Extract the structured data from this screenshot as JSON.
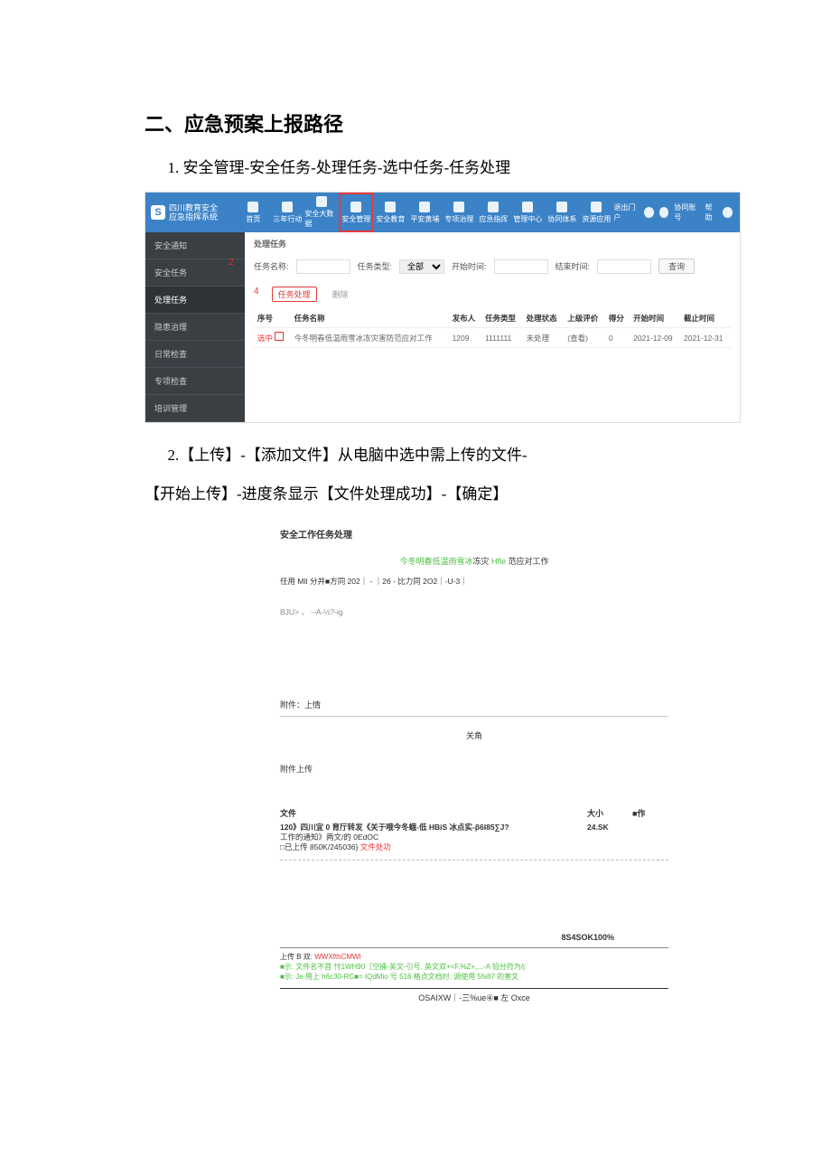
{
  "heading": "二、应急预案上报路径",
  "step1": "1. 安全管理-安全任务-处理任务-选中任务-任务处理",
  "step2a": "2.【上传】-【添加文件】从电脑中选中需上传的文件-",
  "step2b": "【开始上传】-进度条显示【文件处理成功】-【确定】",
  "shot1": {
    "brand1": "四川教育安全",
    "brand2": "应急指挥系统",
    "nav": [
      "首页",
      "三年行动",
      "安全大数据",
      "安全管理",
      "安全教育",
      "平安黄埔",
      "专项治理",
      "应急指挥",
      "管理中心",
      "协同体系",
      "资源应用"
    ],
    "rightnav": [
      "退出门户",
      "消息",
      "代办",
      "协同账号",
      "帮助",
      "在线客服"
    ],
    "sidebar": [
      "安全通知",
      "安全任务",
      "处理任务",
      "隐患治理",
      "日常检查",
      "专项检查",
      "培训管理"
    ],
    "red2": "2",
    "red4": "4",
    "crumb": "处理任务",
    "f_name": "任务名称:",
    "f_type": "任务类型:",
    "f_type_val": "全部",
    "f_start": "开始时间:",
    "f_end": "结束时间:",
    "f_query": "查询",
    "op_handle": "任务处理",
    "op_del": "删除",
    "thead": [
      "序号",
      "任务名称",
      "发布人",
      "任务类型",
      "处理状态",
      "上级评价",
      "得分",
      "开始时间",
      "截止时间"
    ],
    "row": {
      "seq": "",
      "name": "今冬明春低温雨雪冰冻灾害防范应对工作",
      "pub": "1209",
      "type": "1111111",
      "status": "未处理",
      "eval": "(查看)",
      "score": "0",
      "start": "2021-12-09",
      "end": "2021-12-31"
    },
    "selecting": "选中"
  },
  "shot2": {
    "title": "安全工作任务处理",
    "subtitle_a": "今冬明春低温雨雪冰",
    "subtitle_b": "冻灾",
    "subtitle_c": "Hfle",
    "subtitle_d": "范应对工作",
    "meta": "任用 MlI 分并■方同 202｜ - ｜26 - 比力同 2O2｜-U-3｜",
    "editor": "BJU> 、 --A-½?-ig",
    "attach_label": "附件：上情",
    "close": "关角",
    "upload_label": "附件上传",
    "th_file": "文件",
    "th_size": "大小",
    "th_op": "■作",
    "file_line1a": "120》四川宜 0 育厅转发《关于哦今冬蛾-低 HBiS 冰点实-β6I85∑J?",
    "file_line1b": "工作的通知》两文/的 0EdOC",
    "file_size": "24.SK",
    "file_line2a": "□已上传 850K/245036}",
    "file_line2b": "文件处功",
    "pct": "8S4SOK100%",
    "hint1a": "上传 B 双: ",
    "hint1b": "WWXfthCMWI",
    "hint2": "■示: 文件名不首 忖1WH90［空捅-英文-引号. 英文双+<F.%Z+,...-A 铅分符为/j",
    "hint3": "■示: Je 用上 h6c30-RC■= IQdMio 号 516 格点文档时. 调使用 5fs87 的害文",
    "footer": "OSAIXW｜-三%ue④■ 左 Oxce"
  }
}
